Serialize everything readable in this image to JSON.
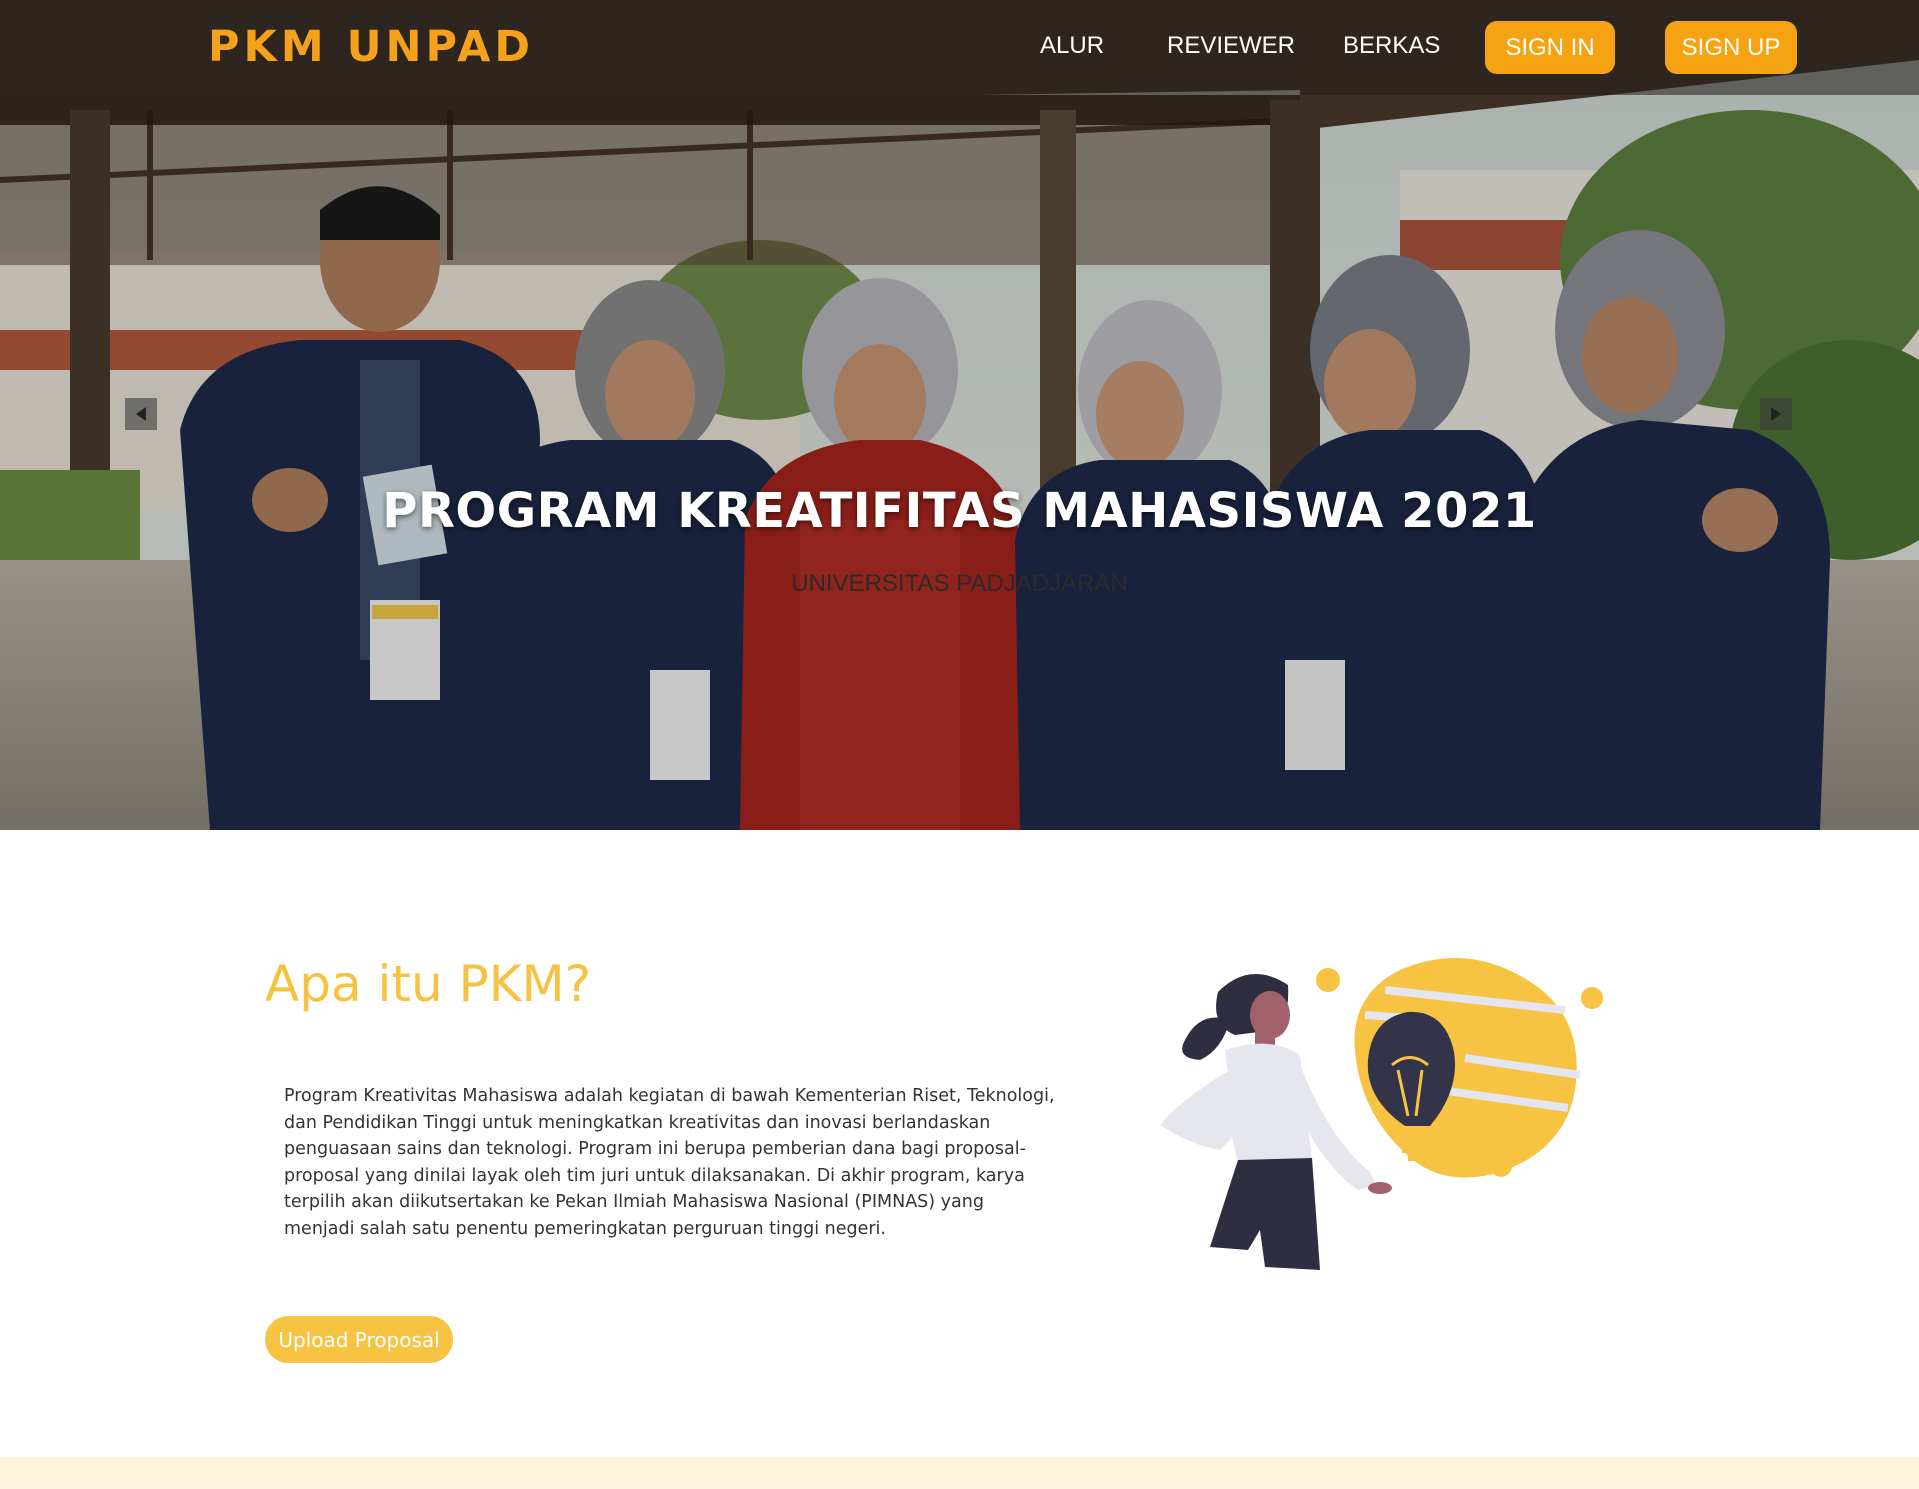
{
  "navbar": {
    "brand": "PKM UNPAD",
    "links": [
      "ALUR",
      "REVIEWER",
      "BERKAS"
    ],
    "sign_in": "SIGN IN",
    "sign_up": "SIGN UP"
  },
  "hero": {
    "title": "PROGRAM KREATIFITAS MAHASISWA 2021",
    "subtitle": "UNIVERSITAS PADJADJARAN"
  },
  "about": {
    "title": "Apa itu PKM?",
    "body": "Program Kreativitas Mahasiswa adalah kegiatan di bawah Kementerian Riset, Teknologi, dan Pendidikan Tinggi untuk meningkatkan kreativitas dan inovasi berlandaskan penguasaan sains dan teknologi. Program ini berupa pemberian dana bagi proposal-proposal yang dinilai layak oleh tim juri untuk dilaksanakan. Di akhir program, karya terpilih akan diikutsertakan ke Pekan Ilmiah Mahasiswa Nasional (PIMNAS) yang menjadi salah satu penentu pemeringkatan perguruan tinggi negeri.",
    "upload_button": "Upload Proposal"
  },
  "colors": {
    "brand_orange": "#f4a21c",
    "button_orange": "#f5a312",
    "heading_yellow": "#f6c242",
    "footer_cream": "#fef4dc"
  },
  "icons": {
    "prev": "chevron-left-icon",
    "next": "chevron-right-icon"
  }
}
